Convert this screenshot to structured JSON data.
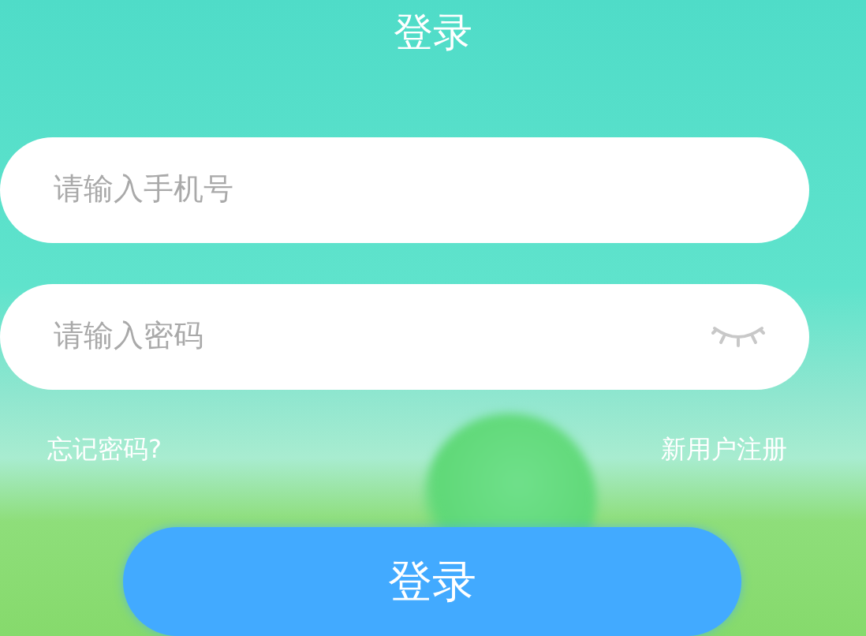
{
  "title": "登录",
  "phone_field": {
    "placeholder": "请输入手机号"
  },
  "password_field": {
    "placeholder": "请输入密码",
    "password_visible": false
  },
  "forgot_link": "忘记密码?",
  "register_link": "新用户注册",
  "login_button": "登录"
}
